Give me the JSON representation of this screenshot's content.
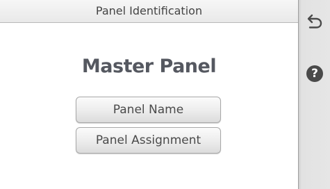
{
  "header": {
    "title": "Panel Identification"
  },
  "main": {
    "heading": "Master Panel",
    "buttons": {
      "panel_name": "Panel Name",
      "panel_assignment": "Panel Assignment"
    }
  },
  "sidebar": {
    "back_icon": "back-arrow-icon",
    "help_icon": "help-icon",
    "help_glyph": "?"
  }
}
